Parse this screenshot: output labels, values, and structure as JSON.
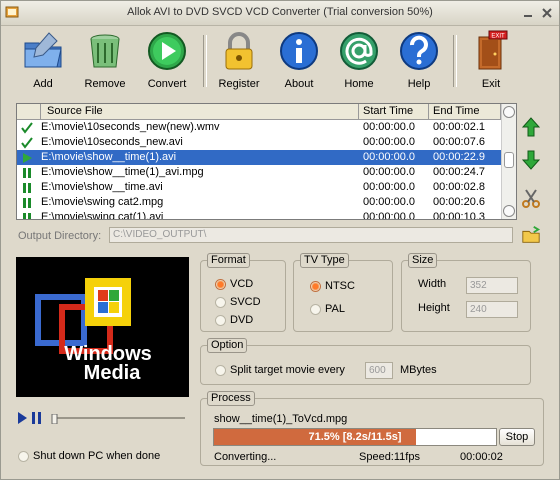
{
  "window": {
    "title": "Allok AVI to DVD SVCD VCD Converter  (Trial conversion 50%)"
  },
  "toolbar": {
    "add": "Add",
    "remove": "Remove",
    "convert": "Convert",
    "register": "Register",
    "about": "About",
    "home": "Home",
    "help": "Help",
    "exit": "Exit"
  },
  "file_list": {
    "columns": [
      "Source File",
      "Start Time",
      "End Time"
    ],
    "rows": [
      {
        "file": "E:\\movie\\10seconds_new(new).wmv",
        "start": "00:00:00.0",
        "end": "00:00:02.1",
        "status": "done"
      },
      {
        "file": "E:\\movie\\10seconds_new.avi",
        "start": "00:00:00.0",
        "end": "00:00:07.6",
        "status": "done"
      },
      {
        "file": "E:\\movie\\show__time(1).avi",
        "start": "00:00:00.0",
        "end": "00:00:22.9",
        "status": "converting"
      },
      {
        "file": "E:\\movie\\show__time(1)_avi.mpg",
        "start": "00:00:00.0",
        "end": "00:00:24.7",
        "status": "pending"
      },
      {
        "file": "E:\\movie\\show__time.avi",
        "start": "00:00:00.0",
        "end": "00:00:02.8",
        "status": "pending"
      },
      {
        "file": "E:\\movie\\swing cat2.mpg",
        "start": "00:00:00.0",
        "end": "00:00:20.6",
        "status": "pending"
      },
      {
        "file": "E:\\movie\\swing cat(1).avi",
        "start": "00:00:00.0",
        "end": "00:00:10.3",
        "status": "pending"
      }
    ]
  },
  "output": {
    "label": "Output Directory:",
    "value": "C:\\VIDEO_OUTPUT\\"
  },
  "preview": {
    "logo_line1": "Windows",
    "logo_line2": "Media",
    "progress": 0.0
  },
  "format": {
    "title": "Format",
    "options": [
      "VCD",
      "SVCD",
      "DVD"
    ],
    "selected": "VCD"
  },
  "tv_type": {
    "title": "TV Type",
    "options": [
      "NTSC",
      "PAL"
    ],
    "selected": "NTSC"
  },
  "size": {
    "title": "Size",
    "width_label": "Width",
    "width_value": "352",
    "height_label": "Height",
    "height_value": "240"
  },
  "option": {
    "title": "Option",
    "split_label": "Split target movie every",
    "split_value": "600",
    "split_unit": "MBytes",
    "shutdown_label": "Shut down PC when done"
  },
  "process": {
    "title": "Process",
    "filename": "show__time(1)_ToVcd.mpg",
    "progress": 0.715,
    "progress_text": "71.5%  [8.2s/11.5s]",
    "stop": "Stop",
    "status": "Converting...",
    "speed": "Speed:11fps",
    "time": "00:00:02"
  },
  "colors": {
    "background": "#ded9cb",
    "selection": "#316ac5",
    "progress_fill": "#d06a3e",
    "radio_on": "#ff7a2a"
  }
}
